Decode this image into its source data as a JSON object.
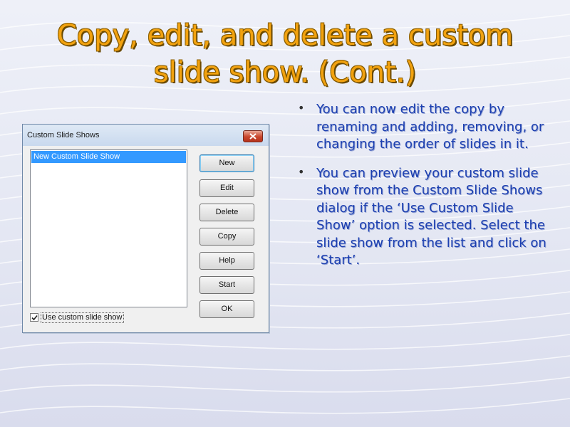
{
  "slide": {
    "title_line1": "Copy, edit, and delete a custom",
    "title_line2": "slide show. (Cont.)",
    "bullets": [
      "You can now edit the copy by renaming and adding, removing, or changing the order of slides in it.",
      "You can preview your custom slide show from the Custom Slide Shows dialog if the ‘Use Custom Slide Show’ option is selected. Select the slide show from the list and click on ‘Start’."
    ],
    "bullet_glyph": "•"
  },
  "dialog": {
    "title": "Custom Slide Shows",
    "close_icon": "close-icon",
    "list_items": [
      "New Custom Slide Show"
    ],
    "buttons": {
      "new": "New",
      "edit": "Edit",
      "delete": "Delete",
      "copy": "Copy",
      "help": "Help",
      "start": "Start",
      "ok": "OK"
    },
    "use_custom_checkbox": {
      "label": "Use custom slide show",
      "checked": true
    }
  },
  "colors": {
    "title": "#f2a20f",
    "bullet_text": "#1c3fb0",
    "selection": "#3399ff"
  }
}
